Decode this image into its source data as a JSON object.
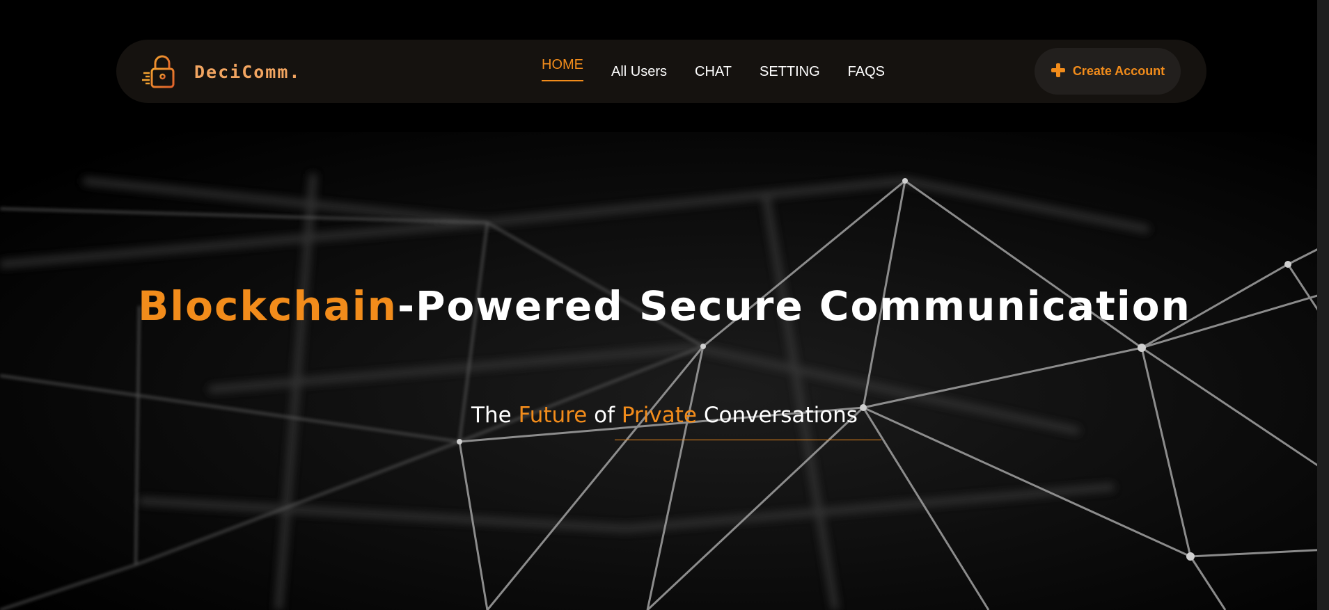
{
  "brand": {
    "name": "DeciComm.",
    "logo_icon": "padlock-icon"
  },
  "nav": {
    "items": [
      {
        "label": "HOME",
        "active": true
      },
      {
        "label": "All Users",
        "active": false
      },
      {
        "label": "CHAT",
        "active": false
      },
      {
        "label": "SETTING",
        "active": false
      },
      {
        "label": "FAQS",
        "active": false
      }
    ],
    "cta": {
      "label": "Create Account",
      "icon": "plus-icon"
    }
  },
  "hero": {
    "title_accent": "Blockchain",
    "title_rest": "-Powered Secure Communication",
    "subtitle": {
      "w1": "The",
      "w2": "Future",
      "w3": "of",
      "w4": "Private",
      "w5": "Conversations"
    },
    "background": "network-mesh-image"
  },
  "colors": {
    "accent": "#f28c1b",
    "nav_bg": "#15120f",
    "button_bg": "#221f1d",
    "page_bg": "#000000"
  }
}
